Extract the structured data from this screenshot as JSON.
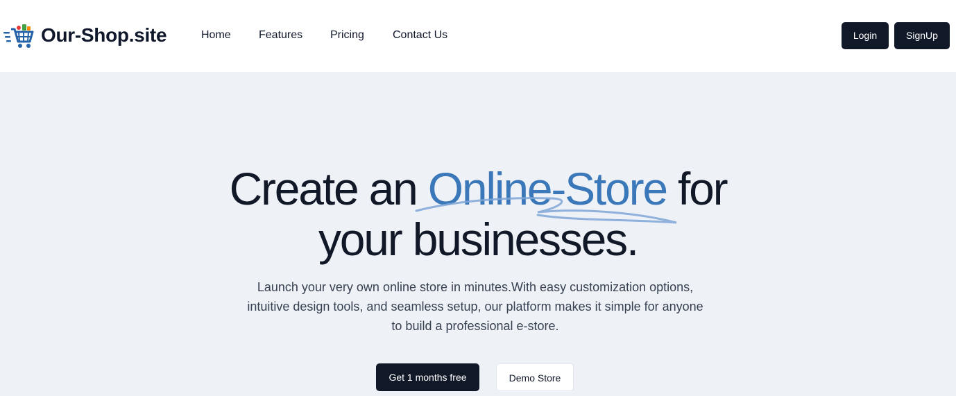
{
  "brand": {
    "name": "Our-Shop.site",
    "logo_icon": "shopping-cart-icon"
  },
  "nav": {
    "items": [
      {
        "label": "Home"
      },
      {
        "label": "Features"
      },
      {
        "label": "Pricing"
      },
      {
        "label": "Contact Us"
      }
    ]
  },
  "auth": {
    "login_label": "Login",
    "signup_label": "SignUp"
  },
  "hero": {
    "headline_start": "Create an ",
    "headline_accent": "Online-Store",
    "headline_end": " for",
    "headline_line2": "your businesses.",
    "subtext": "Launch your very own online store in minutes.With easy customization options, intuitive design tools, and seamless setup, our platform makes it simple for anyone to build a professional e-store.",
    "primary_cta": "Get 1 months free",
    "secondary_cta": "Demo Store"
  },
  "colors": {
    "accent": "#3b78b9",
    "dark": "#111827",
    "hero_bg": "#eef1f6"
  }
}
